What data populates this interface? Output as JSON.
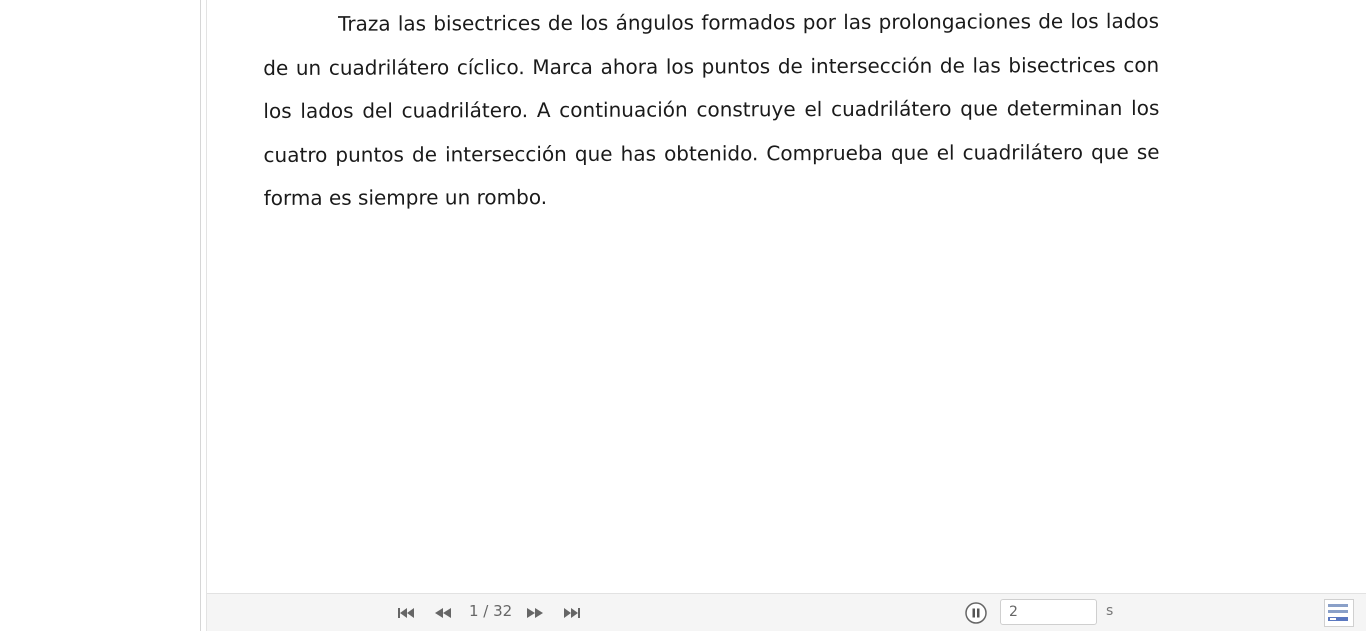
{
  "problem": {
    "text": "Traza las bisectrices de los ángulos formados por las prolongaciones de los lados de un cuadrilátero cíclico. Marca ahora los puntos de intersección de las bisectrices con los lados del cuadrilátero. A continuación construye el cuadrilátero que determinan los cuatro puntos de intersección que has obtenido. Comprueba que el cuadrilátero que se forma es siempre un rombo."
  },
  "navigation": {
    "current_step": "1",
    "total_steps": "32",
    "step_label": "1 / 32",
    "first_icon": "skip-first-icon",
    "prev_icon": "rewind-icon",
    "next_icon": "fast-forward-icon",
    "last_icon": "skip-last-icon",
    "play_state": "playing",
    "pause_icon": "pause-icon",
    "speed_value": "2",
    "speed_unit": "s",
    "algebra_icon": "algebra-view-icon"
  },
  "colors": {
    "text": "#1a1a1a",
    "nav_bg": "#f5f5f5",
    "icon": "#666666"
  }
}
